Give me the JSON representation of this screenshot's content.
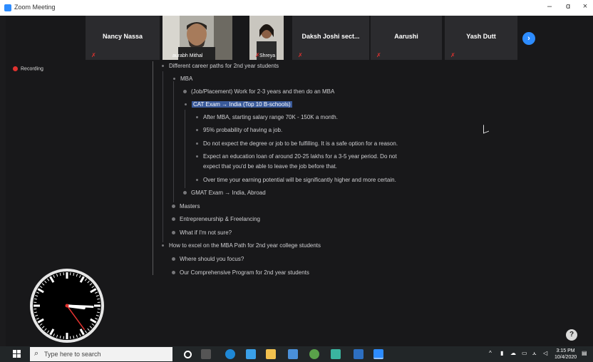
{
  "window": {
    "title": "Zoom Meeting",
    "minimize": "–",
    "maximize": "ɑ",
    "close": "×"
  },
  "participants": [
    {
      "name": "Nancy Nassa",
      "video": false,
      "muted": true
    },
    {
      "name": "aurabh Mithal",
      "video": true,
      "muted": false
    },
    {
      "name": "Shreya",
      "video": true,
      "muted": true
    },
    {
      "name": "Daksh Joshi sect...",
      "video": false,
      "muted": true
    },
    {
      "name": "Aarushi",
      "video": false,
      "muted": true
    },
    {
      "name": "Yash Dutt",
      "video": false,
      "muted": true
    }
  ],
  "recording_label": "Recording",
  "document": {
    "lines": [
      {
        "text": "Different career paths for 2nd year students",
        "level": 0
      },
      {
        "text": "MBA",
        "level": 1
      },
      {
        "text": "(Job/Placement) Work for 2-3 years and then do an MBA",
        "level": 2
      },
      {
        "text": "CAT Exam → India (Top 10 B-schools)",
        "level": 2,
        "highlight": true
      },
      {
        "text": "After MBA, starting salary range 70K - 150K a month.",
        "level": 3
      },
      {
        "text": "95% probability of having a job.",
        "level": 3
      },
      {
        "text": "Do not expect the degree or job to be fulfilling. It is a safe option for a reason.",
        "level": 3
      },
      {
        "text": "Expect an education loan of around 20-25 lakhs for a 3-5 year period. Do not",
        "level": 3
      },
      {
        "text": "expect that you'd be able to leave the job before that.",
        "level": 3,
        "continuation": true
      },
      {
        "text": "Over time your earning potential will be significantly higher and more certain.",
        "level": 3
      },
      {
        "text": "GMAT Exam → India, Abroad",
        "level": 2
      },
      {
        "text": "Masters",
        "level": 1
      },
      {
        "text": "Entrepreneurship & Freelancing",
        "level": 1
      },
      {
        "text": "What if I'm not sure?",
        "level": 1
      },
      {
        "text": "How to excel on the MBA Path for 2nd year college students",
        "level": 0
      },
      {
        "text": "Where should you focus?",
        "level": 1
      },
      {
        "text": "Our Comprehensive Program for 2nd year students",
        "level": 1
      }
    ]
  },
  "clock": {
    "hour": 3,
    "minute": 15,
    "second": 24
  },
  "taskbar": {
    "search_placeholder": "Type here to search",
    "time": "3:15 PM",
    "date": "10/4/2020"
  },
  "colors": {
    "accent": "#2d8cff",
    "mute": "#e0322f",
    "highlight": "#3a5a9a"
  }
}
